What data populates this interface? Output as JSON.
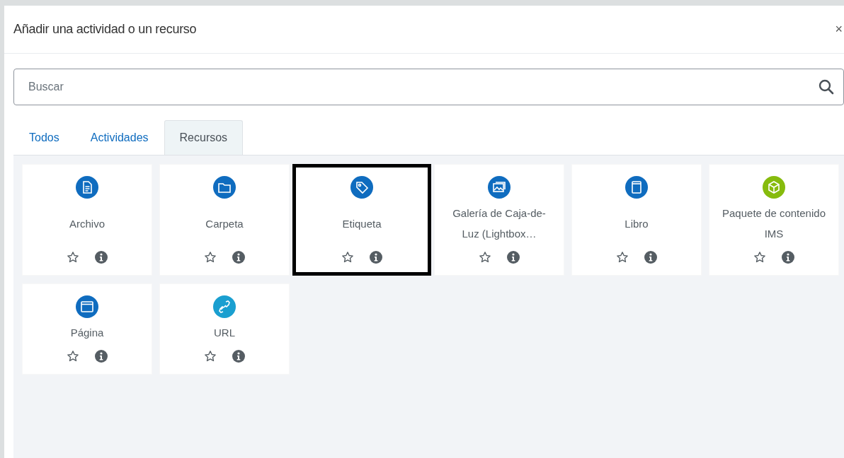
{
  "window": {
    "title": "Añadir una actividad o un recurso",
    "close": "×"
  },
  "search": {
    "placeholder": "Buscar"
  },
  "tabs": [
    {
      "label": "Todos",
      "selected": false
    },
    {
      "label": "Actividades",
      "selected": false
    },
    {
      "label": "Recursos",
      "selected": true
    }
  ],
  "items": [
    {
      "label": "Archivo",
      "kind": "file",
      "color": "#0f6cbf",
      "selected": false
    },
    {
      "label": "Carpeta",
      "kind": "folder",
      "color": "#0f6cbf",
      "selected": false
    },
    {
      "label": "Etiqueta",
      "kind": "tag",
      "color": "#0f6cbf",
      "selected": true
    },
    {
      "label": "Galería de Caja-de-Luz (Lightbox…",
      "kind": "gallery",
      "color": "#0f6cbf",
      "selected": false
    },
    {
      "label": "Libro",
      "kind": "book",
      "color": "#0f6cbf",
      "selected": false
    },
    {
      "label": "Paquete de contenido IMS",
      "kind": "package",
      "color": "#86bb0d",
      "selected": false
    },
    {
      "label": "Página",
      "kind": "page",
      "color": "#0f6cbf",
      "selected": false
    },
    {
      "label": "URL",
      "kind": "link",
      "color": "#1a9fd0",
      "selected": false
    }
  ]
}
